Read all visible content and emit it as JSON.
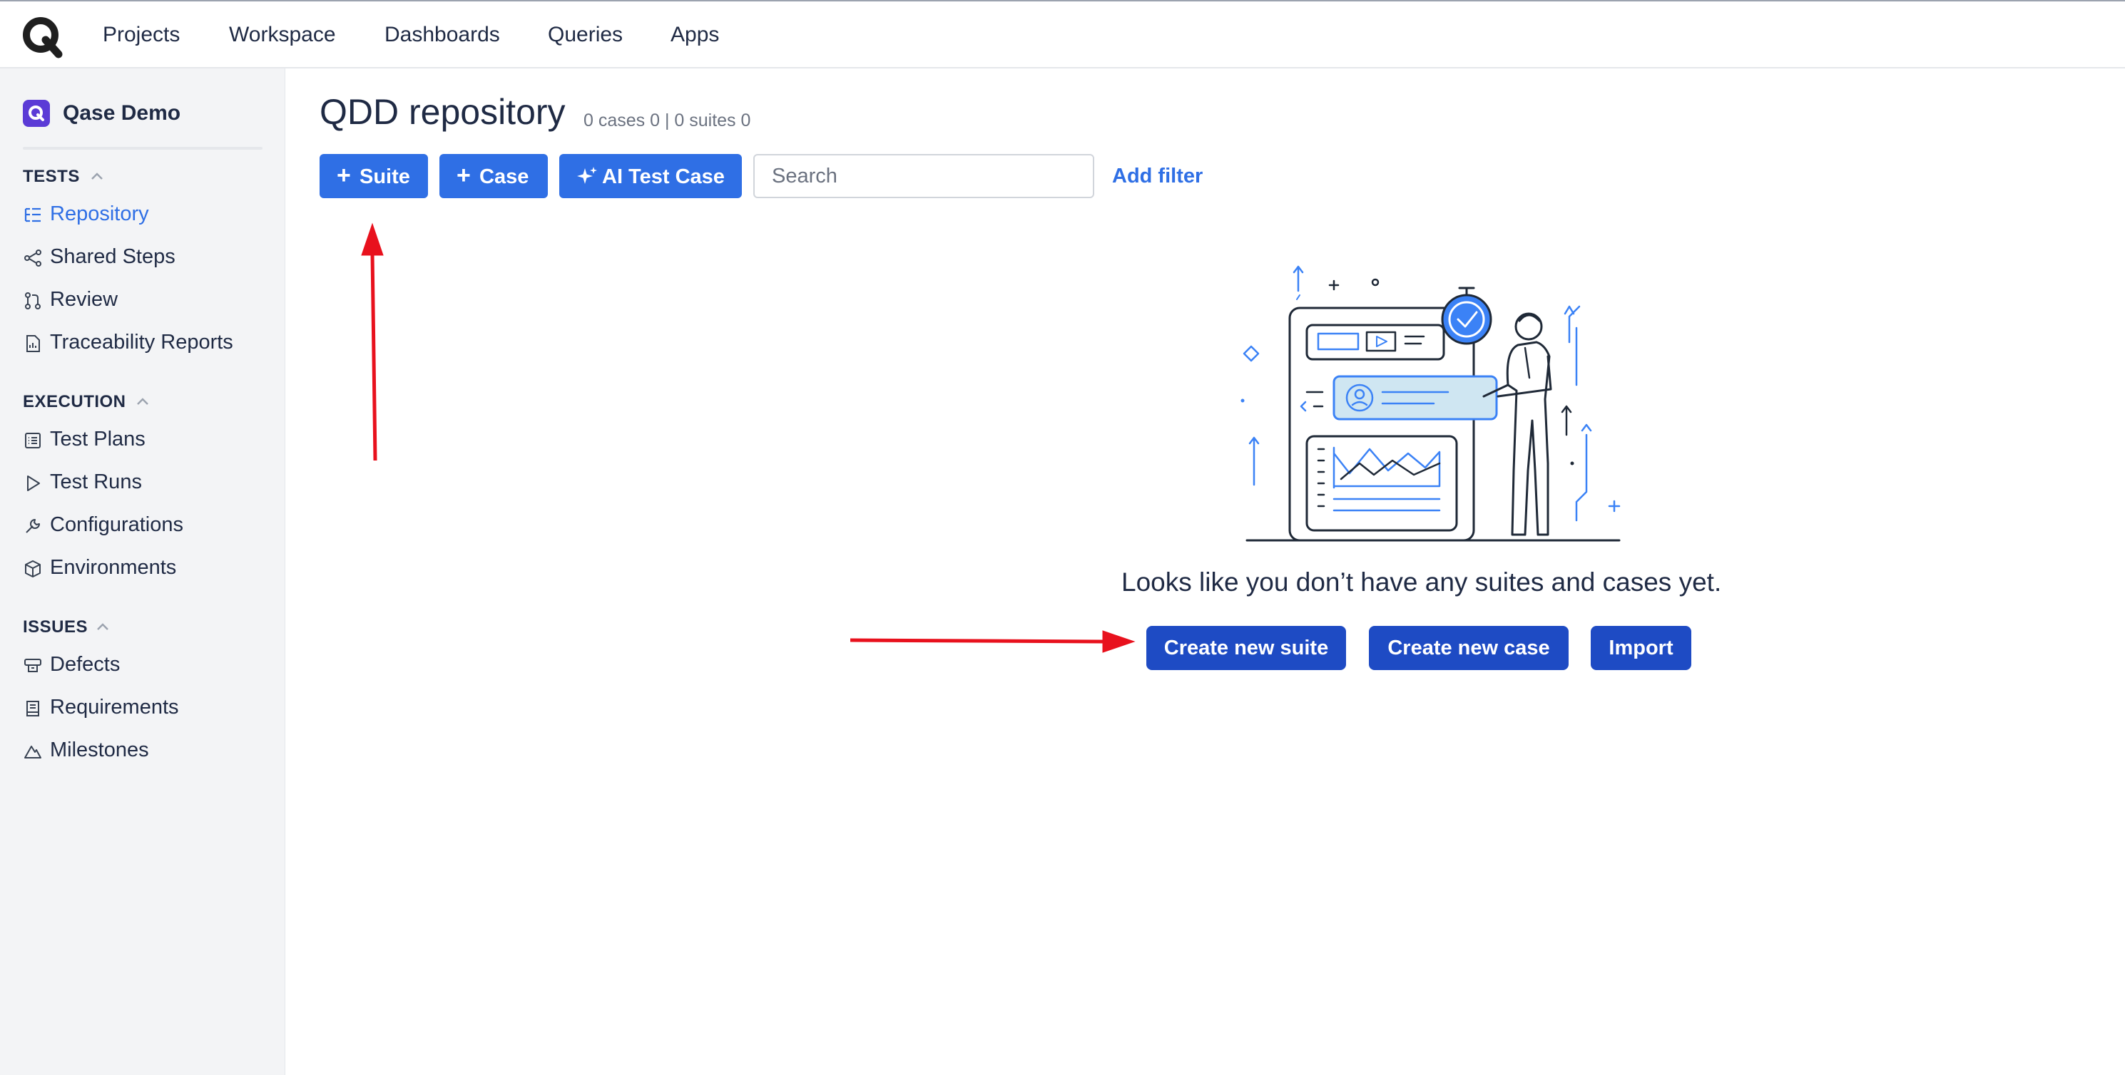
{
  "topnav": {
    "items": [
      "Projects",
      "Workspace",
      "Dashboards",
      "Queries",
      "Apps"
    ]
  },
  "sidebar": {
    "project_name": "Qase Demo",
    "sections": [
      {
        "title": "TESTS",
        "items": [
          "Repository",
          "Shared Steps",
          "Review",
          "Traceability Reports"
        ]
      },
      {
        "title": "EXECUTION",
        "items": [
          "Test Plans",
          "Test Runs",
          "Configurations",
          "Environments"
        ]
      },
      {
        "title": "ISSUES",
        "items": [
          "Defects",
          "Requirements",
          "Milestones"
        ]
      }
    ],
    "active_item": "Repository"
  },
  "main": {
    "title": "QDD repository",
    "stats": "0 cases 0 | 0 suites 0",
    "toolbar": {
      "suite_label": "Suite",
      "case_label": "Case",
      "ai_label": "AI Test Case",
      "search_placeholder": "Search",
      "add_filter_label": "Add filter"
    },
    "empty_state": {
      "message": "Looks like you don’t have any suites and cases yet.",
      "create_suite_label": "Create new suite",
      "create_case_label": "Create new case",
      "import_label": "Import"
    }
  },
  "colors": {
    "primary": "#2f6fe5",
    "primary_dark": "#1e4bc4",
    "annotation_arrow": "#e8111d",
    "sidebar_bg": "#f3f4f6"
  }
}
